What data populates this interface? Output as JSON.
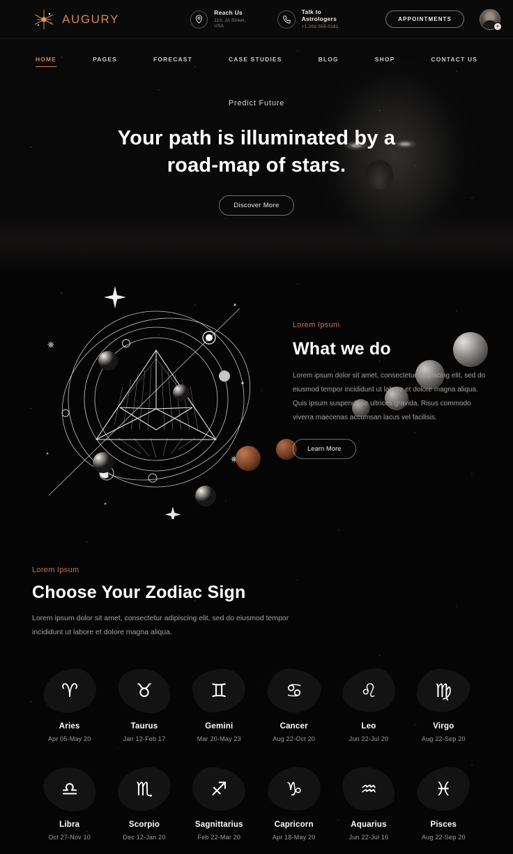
{
  "brand": {
    "name": "AUGURY",
    "logo_icon": "starburst-icon",
    "accent": "#d08a52"
  },
  "topbar": {
    "reach": {
      "icon": "map-pin-icon",
      "title": "Reach Us",
      "sub": "113, JA Street, USA"
    },
    "talk": {
      "icon": "phone-icon",
      "title": "Talk to Astrologers",
      "sub": "+1-202-555-0181"
    },
    "appointments_label": "APPOINTMENTS",
    "avatar_badge_icon": "user-add-icon"
  },
  "nav": {
    "items": [
      {
        "label": "HOME",
        "active": true
      },
      {
        "label": "PAGES",
        "active": false
      },
      {
        "label": "FORECAST",
        "active": false
      },
      {
        "label": "CASE STUDIES",
        "active": false
      },
      {
        "label": "BLOG",
        "active": false
      },
      {
        "label": "SHOP",
        "active": false
      },
      {
        "label": "CONTACT US",
        "active": false
      }
    ]
  },
  "hero": {
    "kicker": "Predict Future",
    "title_line1": "Your path is illuminated by a",
    "title_line2": "road-map of stars.",
    "cta_label": "Discover More"
  },
  "about": {
    "eyebrow": "Lorem Ipsum",
    "heading": "What we do",
    "paragraph": "Lorem ipsum dolor sit amet, consectetur adipiscing elit, sed do eiusmod tempor incididunt ut labore et dolore magna aliqua. Quis ipsum suspendisse ultrices gravida. Risus commodo viverra maecenas accumsan lacus vel facilisis.",
    "cta_label": "Learn More"
  },
  "zodiac": {
    "eyebrow": "Lorem Ipsum",
    "heading": "Choose Your Zodiac Sign",
    "description": "Lorem ipsum dolor sit amet, consectetur adipiscing elit, sed do eiusmod tempor incididunt ut labore et dolore magna aliqua.",
    "signs": [
      {
        "name": "Aries",
        "dates": "Apr 05-May 20",
        "glyph": "♈"
      },
      {
        "name": "Taurus",
        "dates": "Jan 12-Feb 17",
        "glyph": "♉"
      },
      {
        "name": "Gemini",
        "dates": "Mar 20-May 23",
        "glyph": "♊"
      },
      {
        "name": "Cancer",
        "dates": "Aug 22-Oct 20",
        "glyph": "♋"
      },
      {
        "name": "Leo",
        "dates": "Jun 22-Jul 20",
        "glyph": "♌"
      },
      {
        "name": "Virgo",
        "dates": "Aug 22-Sep 20",
        "glyph": "♍"
      },
      {
        "name": "Libra",
        "dates": "Oct 27-Nov 10",
        "glyph": "♎"
      },
      {
        "name": "Scorpio",
        "dates": "Dec 12-Jan 20",
        "glyph": "♏"
      },
      {
        "name": "Sagnittarius",
        "dates": "Feb 22-Mar 20",
        "glyph": "♐"
      },
      {
        "name": "Capricorn",
        "dates": "Apr 18-May 20",
        "glyph": "♑"
      },
      {
        "name": "Aquarius",
        "dates": "Jun 22-Jul 16",
        "glyph": "♒"
      },
      {
        "name": "Pisces",
        "dates": "Aug 22-Sep 20",
        "glyph": "♓"
      }
    ]
  }
}
